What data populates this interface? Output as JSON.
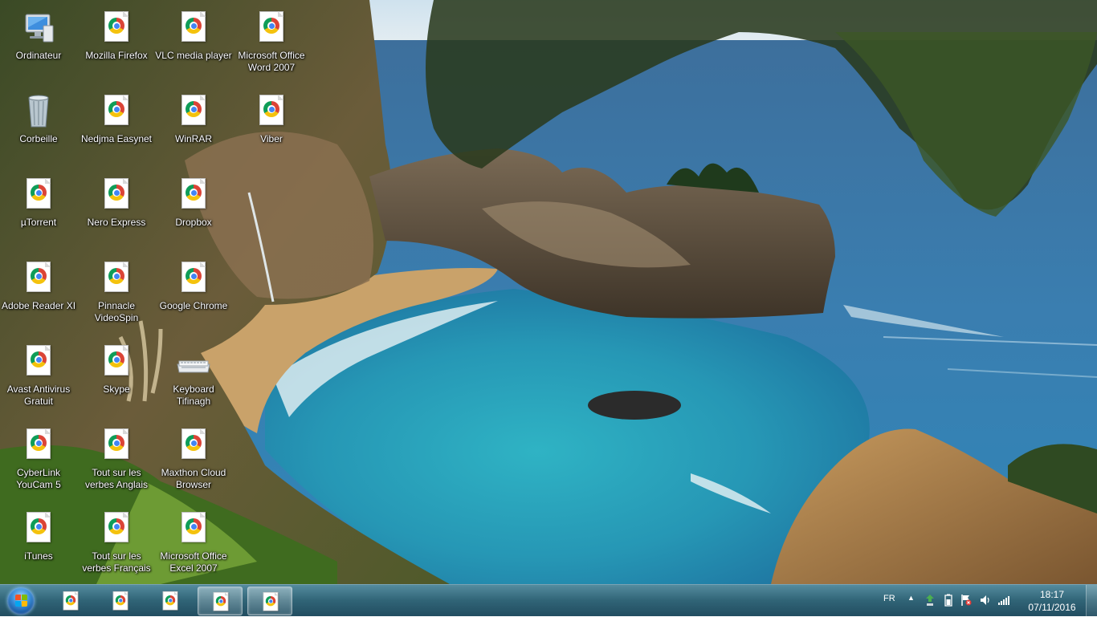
{
  "desktop": {
    "icons": [
      {
        "label": "Ordinateur",
        "icon": "computer-icon"
      },
      {
        "label": "Mozilla Firefox",
        "icon": "chrome-icon"
      },
      {
        "label": "VLC media player",
        "icon": "chrome-icon"
      },
      {
        "label": "Microsoft Office Word 2007",
        "icon": "chrome-icon"
      },
      {
        "label": "Corbeille",
        "icon": "recycle-bin-icon"
      },
      {
        "label": "Nedjma Easynet",
        "icon": "chrome-icon"
      },
      {
        "label": "WinRAR",
        "icon": "chrome-icon"
      },
      {
        "label": "Viber",
        "icon": "chrome-icon"
      },
      {
        "label": "µTorrent",
        "icon": "chrome-icon"
      },
      {
        "label": "Nero Express",
        "icon": "chrome-icon"
      },
      {
        "label": "Dropbox",
        "icon": "chrome-icon"
      },
      {
        "label": "Adobe Reader XI",
        "icon": "chrome-icon"
      },
      {
        "label": "Pinnacle VideoSpin",
        "icon": "chrome-icon"
      },
      {
        "label": "Google Chrome",
        "icon": "chrome-icon"
      },
      {
        "label": "Avast Antivirus Gratuit",
        "icon": "chrome-icon"
      },
      {
        "label": "Skype",
        "icon": "chrome-icon"
      },
      {
        "label": "Keyboard Tifinagh",
        "icon": "keyboard-icon"
      },
      {
        "label": "CyberLink YouCam 5",
        "icon": "chrome-icon"
      },
      {
        "label": "Tout sur les verbes Anglais",
        "icon": "chrome-icon"
      },
      {
        "label": "Maxthon Cloud Browser",
        "icon": "chrome-icon"
      },
      {
        "label": "iTunes",
        "icon": "chrome-icon"
      },
      {
        "label": "Tout sur les verbes Français",
        "icon": "chrome-icon"
      },
      {
        "label": "Microsoft Office Excel 2007",
        "icon": "chrome-icon"
      }
    ]
  },
  "taskbar": {
    "start_icon": "windows-start-orb-icon",
    "pinned": [
      {
        "icon": "chrome-icon",
        "active": false
      },
      {
        "icon": "chrome-icon",
        "active": false
      },
      {
        "icon": "chrome-icon",
        "active": false
      },
      {
        "icon": "chrome-icon",
        "active": true
      },
      {
        "icon": "chrome-icon",
        "active": true
      }
    ],
    "tray": {
      "language": "FR",
      "time": "18:17",
      "date": "07/11/2016"
    }
  }
}
